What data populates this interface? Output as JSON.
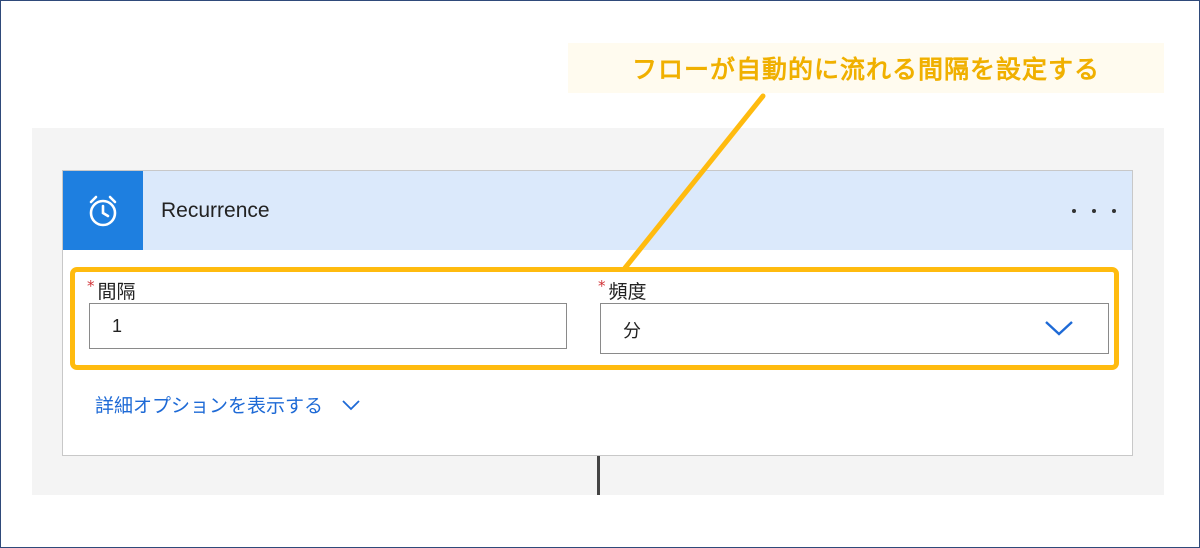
{
  "callout": {
    "text": "フローが自動的に流れる間隔を設定する"
  },
  "card": {
    "title": "Recurrence",
    "icon": "alarm-clock-icon",
    "more_icon": "more-options-icon"
  },
  "fields": {
    "interval": {
      "required_mark": "*",
      "label": "間隔",
      "value": "1"
    },
    "frequency": {
      "required_mark": "*",
      "label": "頻度",
      "value": "分"
    }
  },
  "advanced": {
    "label": "詳細オプションを表示する"
  },
  "colors": {
    "accent_blue": "#1e7fe0",
    "header_bg": "#dbe9fb",
    "highlight": "#ffbb0f",
    "link": "#1e6ad6",
    "required": "#d13438"
  }
}
